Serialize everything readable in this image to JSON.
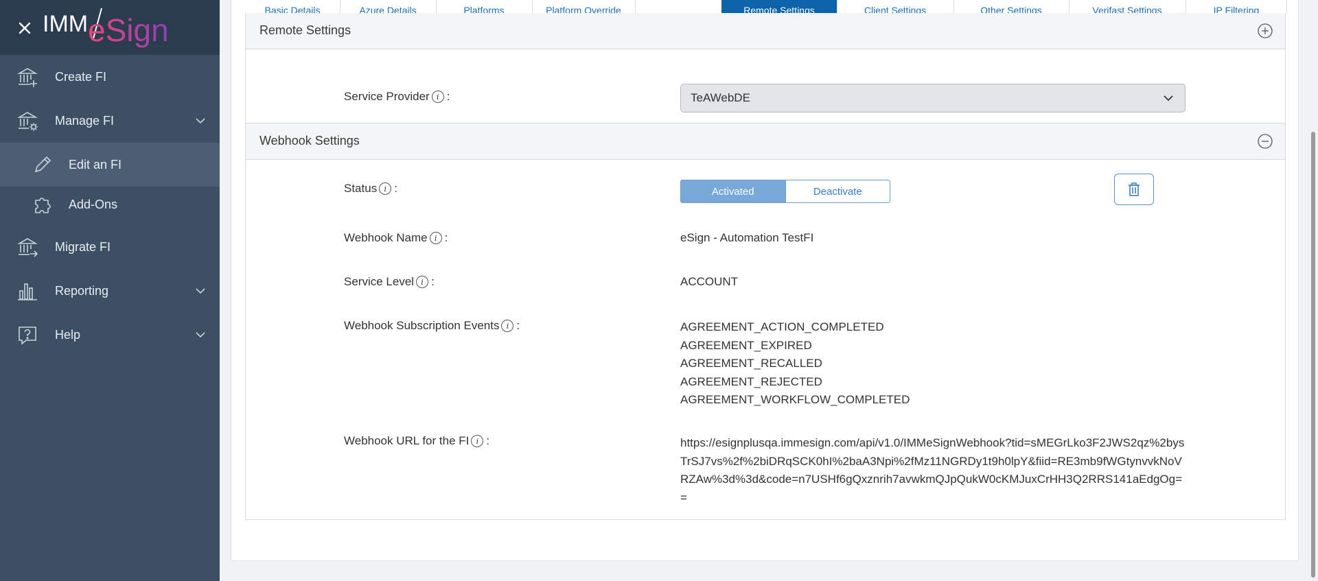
{
  "brand": {
    "prefix": "IMM",
    "suffix": "eSign"
  },
  "sidebar": {
    "items": [
      {
        "label": "Create FI",
        "icon": "bank-plus-icon"
      },
      {
        "label": "Manage FI",
        "icon": "bank-gear-icon",
        "expandable": true
      },
      {
        "label": "Edit an FI",
        "icon": "pencil-icon",
        "active": true
      },
      {
        "label": "Add-Ons",
        "icon": "puzzle-icon"
      },
      {
        "label": "Migrate FI",
        "icon": "bank-arrow-icon"
      },
      {
        "label": "Reporting",
        "icon": "bar-chart-icon",
        "expandable": true
      },
      {
        "label": "Help",
        "icon": "help-bubble-icon",
        "expandable": true
      }
    ]
  },
  "tabs": [
    {
      "label": "Basic Details"
    },
    {
      "label": "Azure Details"
    },
    {
      "label": "Platforms"
    },
    {
      "label": "Platform Override"
    },
    {
      "label": "Remote Settings",
      "active": true
    },
    {
      "label": "Client Settings"
    },
    {
      "label": "Other Settings"
    },
    {
      "label": "Verifast Settings"
    },
    {
      "label": "IP Filtering"
    }
  ],
  "remote_settings": {
    "title": "Remote Settings",
    "service_provider_label": "Service Provider",
    "service_provider_value": "TeAWebDE"
  },
  "webhook_settings": {
    "title": "Webhook Settings",
    "status_label": "Status",
    "status_activated": "Activated",
    "status_deactivate": "Deactivate",
    "name_label": "Webhook Name",
    "name_value": "eSign - Automation TestFI",
    "service_level_label": "Service Level",
    "service_level_value": "ACCOUNT",
    "events_label": "Webhook Subscription Events",
    "events": [
      "AGREEMENT_ACTION_COMPLETED",
      "AGREEMENT_EXPIRED",
      "AGREEMENT_RECALLED",
      "AGREEMENT_REJECTED",
      "AGREEMENT_WORKFLOW_COMPLETED"
    ],
    "url_label": "Webhook URL for the FI",
    "url_value": "https://esignplusqa.immesign.com/api/v1.0/IMMeSignWebhook?tid=sMEGrLko3F2JWS2qz%2bysTrSJ7vs%2f%2biDRqSCK0hI%2baA3Npi%2fMz11NGRDy1t9h0lpY&fiid=RE3mb9fWGtynvvkNoVRZAw%3d%3d&code=n7USHf6gQxznrih7avwkmQJpQukW0cKMJuxCrHH3Q2RRS141aEdgOg=="
  },
  "colors": {
    "sidebar_bg": "#3d4f63",
    "brand_bg": "#2c3c4f",
    "active_tab": "#0d63a8",
    "accent_pink": "#e8477a",
    "accent_purple": "#8d3fb5"
  }
}
